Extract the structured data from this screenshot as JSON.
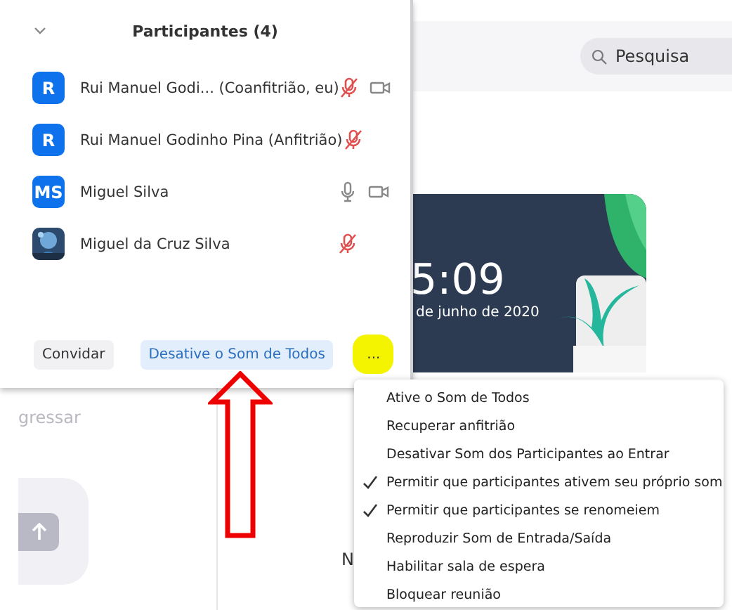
{
  "background": {
    "search": {
      "placeholder": "Pesquisa"
    },
    "clock": {
      "time": "5:09",
      "date": "de junho de 2020"
    },
    "left_label": "gressar",
    "partial_text": "N"
  },
  "participants_panel": {
    "title": "Participantes (4)",
    "participants": [
      {
        "name": "Rui Manuel Godi... (Coanfitrião, eu)",
        "avatar": {
          "kind": "initials",
          "text": "R"
        },
        "muted": true,
        "video": true
      },
      {
        "name": "Rui Manuel Godinho Pina (Anfitrião)",
        "avatar": {
          "kind": "initials",
          "text": "R"
        },
        "muted": true,
        "video": false
      },
      {
        "name": "Miguel Silva",
        "avatar": {
          "kind": "initials",
          "text": "MS"
        },
        "muted": false,
        "video": true
      },
      {
        "name": "Miguel da Cruz Silva",
        "muted": true,
        "video": false
      }
    ],
    "buttons": [
      {
        "label": "Convidar",
        "kind": "plain"
      },
      {
        "label": "Desative o Som de Todos",
        "kind": "primary"
      },
      {
        "label": "...",
        "kind": "more"
      }
    ]
  },
  "more_menu": [
    {
      "label": "Ative o Som de Todos",
      "checked": false
    },
    {
      "label": "Recuperar anfitrião",
      "checked": false
    },
    {
      "label": "Desativar Som dos Participantes ao Entrar",
      "checked": false
    },
    {
      "label": "Permitir que participantes ativem seu próprio som",
      "checked": true
    },
    {
      "label": "Permitir que participantes se renomeiem",
      "checked": true
    },
    {
      "label": "Reproduzir Som de Entrada/Saída",
      "checked": false
    },
    {
      "label": "Habilitar sala de espera",
      "checked": false
    },
    {
      "label": "Bloquear reunião",
      "checked": false
    }
  ]
}
